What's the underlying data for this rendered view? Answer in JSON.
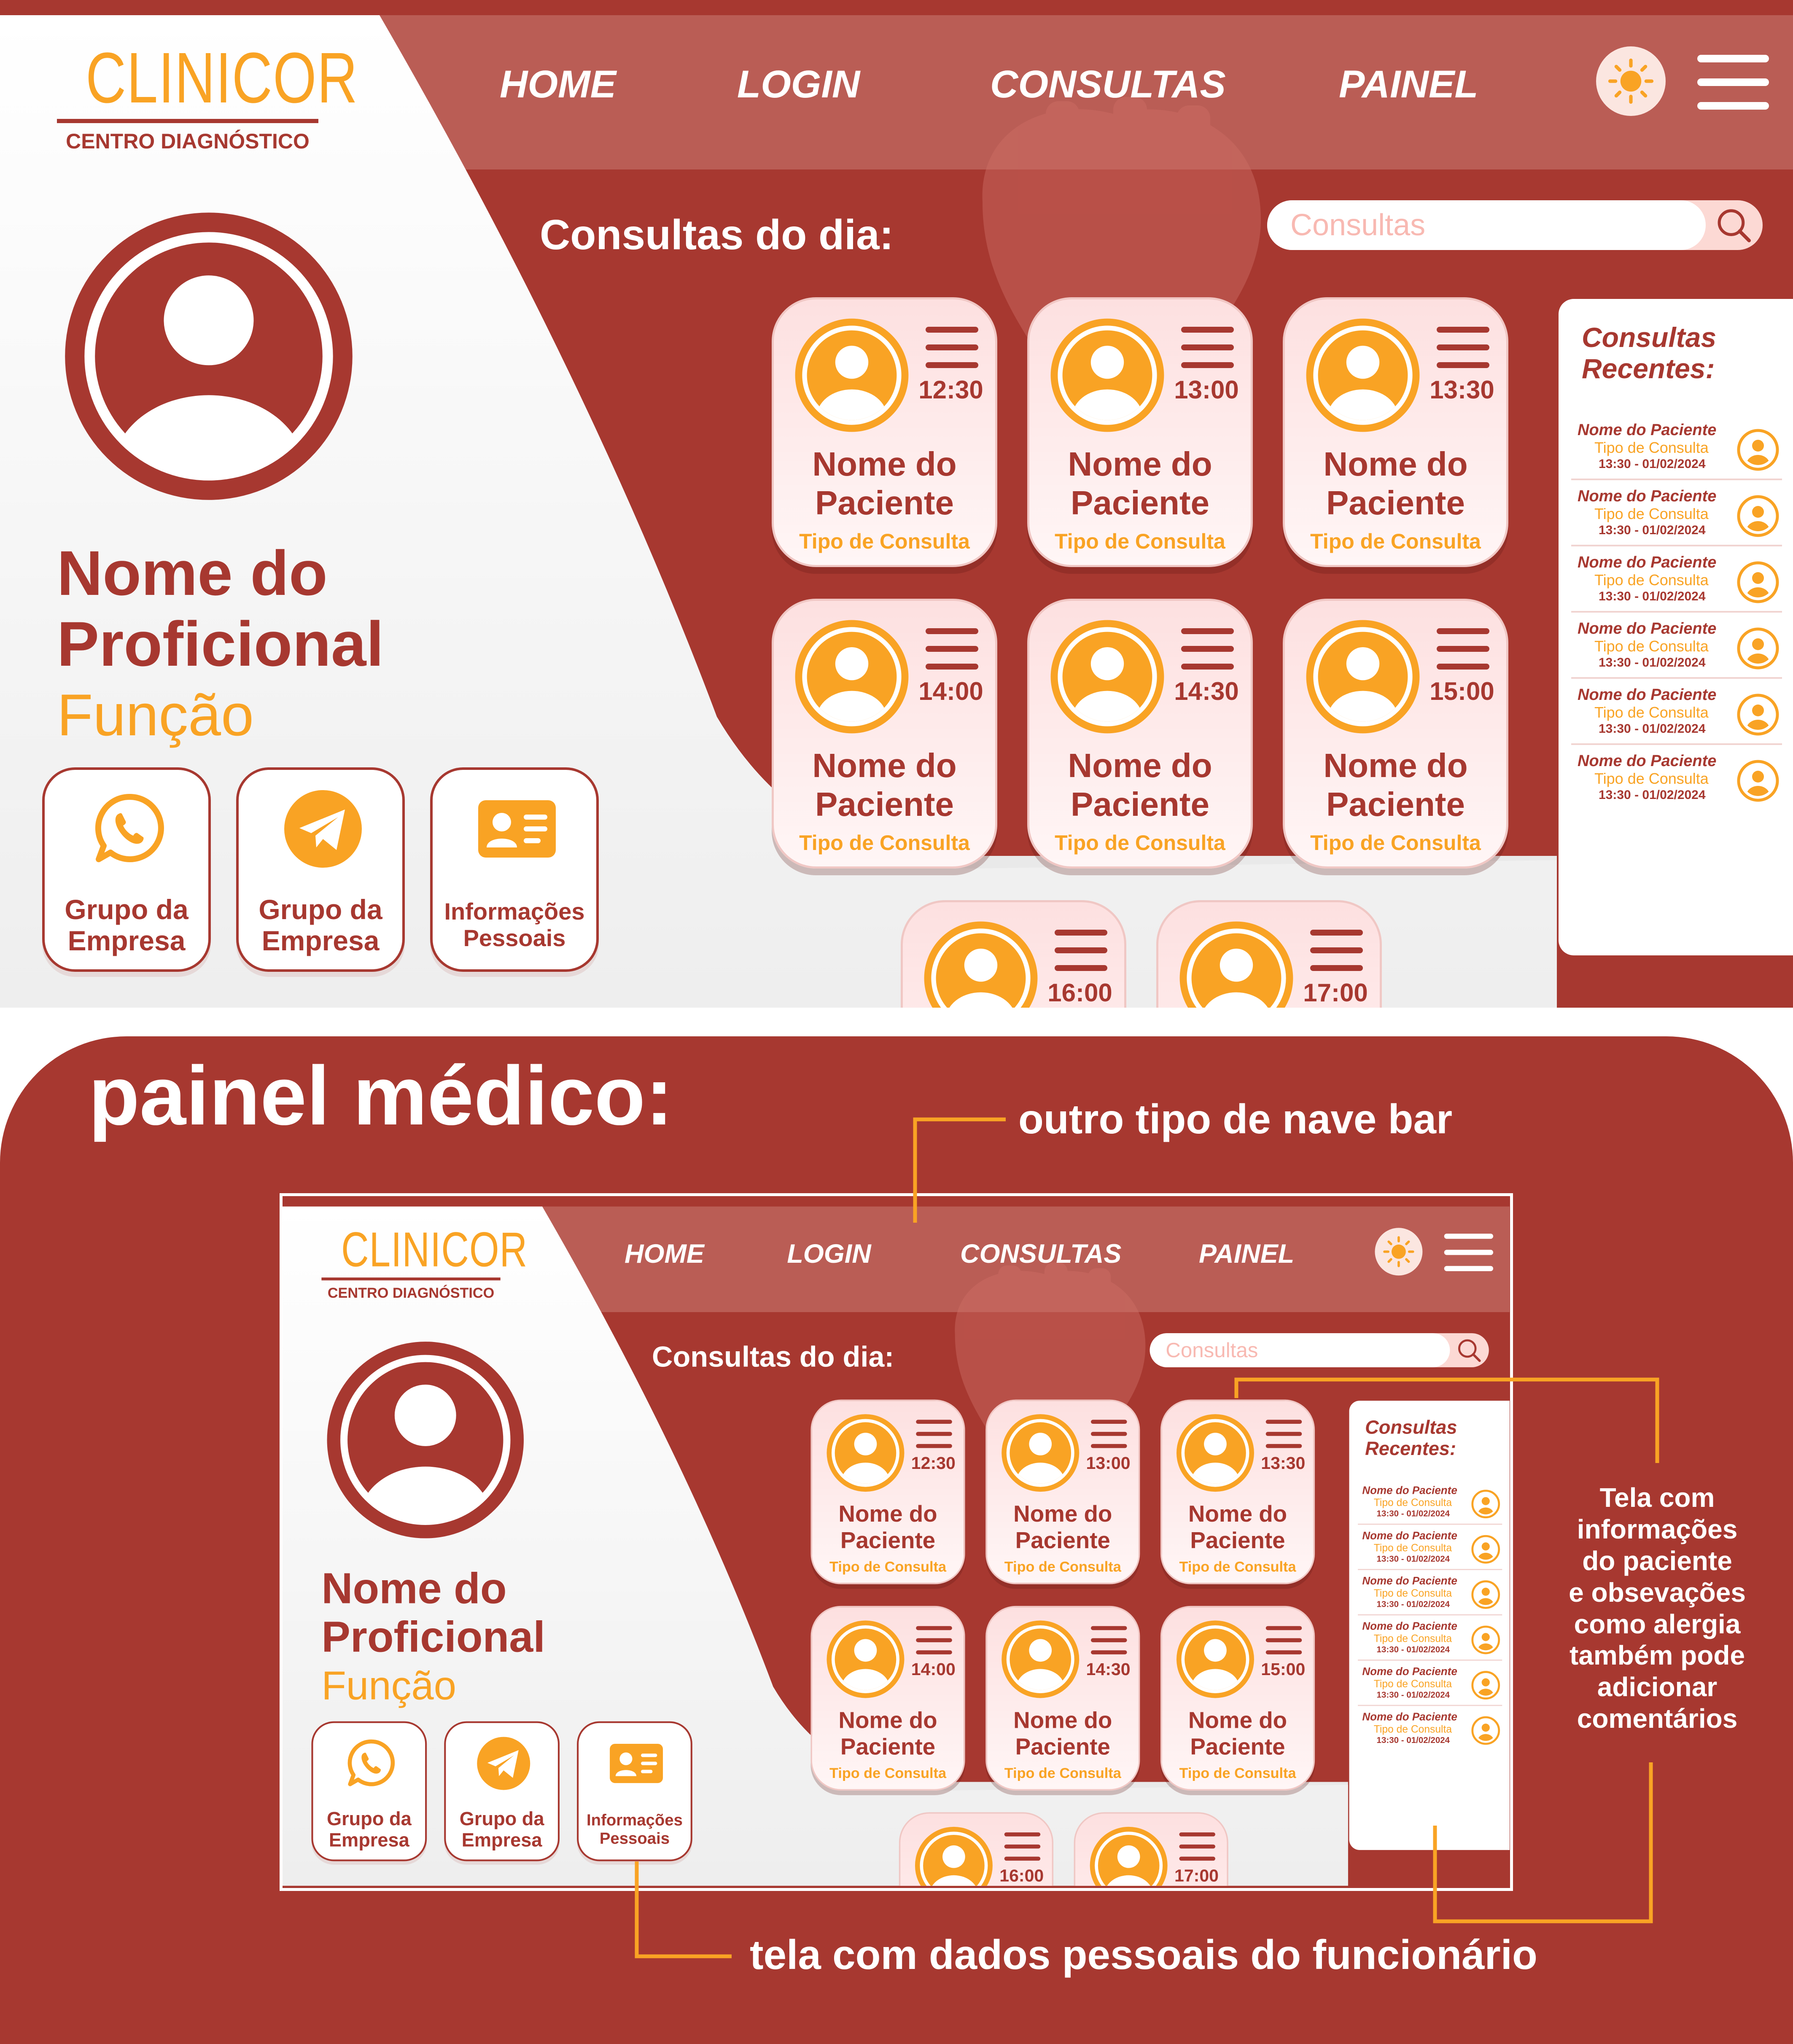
{
  "brand": {
    "name": "CLINICOR",
    "subtitle": "CENTRO DIAGNÓSTICO"
  },
  "nav": {
    "items": [
      "HOME",
      "LOGIN",
      "CONSULTAS",
      "PAINEL"
    ],
    "theme_toggle_icon": "sun-icon",
    "menu_icon": "hamburger-menu-icon"
  },
  "main": {
    "title": "Consultas do dia:",
    "search_placeholder": "Consultas",
    "search_icon": "search-icon"
  },
  "profile": {
    "name": "Nome do\nProficional",
    "role": "Função",
    "buttons": [
      {
        "label": "Grupo da\nEmpresa",
        "icon": "whatsapp-icon"
      },
      {
        "label": "Grupo da\nEmpresa",
        "icon": "telegram-icon"
      },
      {
        "label": "Informações\nPessoais",
        "icon": "id-card-icon"
      }
    ]
  },
  "appointments": [
    {
      "time": "12:30",
      "patient": "Nome do\nPaciente",
      "type": "Tipo de Consulta"
    },
    {
      "time": "13:00",
      "patient": "Nome do\nPaciente",
      "type": "Tipo de Consulta"
    },
    {
      "time": "13:30",
      "patient": "Nome do\nPaciente",
      "type": "Tipo de Consulta"
    },
    {
      "time": "14:00",
      "patient": "Nome do\nPaciente",
      "type": "Tipo de Consulta"
    },
    {
      "time": "14:30",
      "patient": "Nome do\nPaciente",
      "type": "Tipo de Consulta"
    },
    {
      "time": "15:00",
      "patient": "Nome do\nPaciente",
      "type": "Tipo de Consulta"
    },
    {
      "time": "16:00",
      "patient": "",
      "type": ""
    },
    {
      "time": "17:00",
      "patient": "",
      "type": ""
    }
  ],
  "recent": {
    "title": "Consultas\nRecentes:",
    "items": [
      {
        "name": "Nome do Paciente",
        "type": "Tipo de Consulta",
        "datetime": "13:30  -  01/02/2024"
      },
      {
        "name": "Nome do Paciente",
        "type": "Tipo de Consulta",
        "datetime": "13:30  -  01/02/2024"
      },
      {
        "name": "Nome do Paciente",
        "type": "Tipo de Consulta",
        "datetime": "13:30  -  01/02/2024"
      },
      {
        "name": "Nome do Paciente",
        "type": "Tipo de Consulta",
        "datetime": "13:30  -  01/02/2024"
      },
      {
        "name": "Nome do Paciente",
        "type": "Tipo de Consulta",
        "datetime": "13:30  -  01/02/2024"
      },
      {
        "name": "Nome do Paciente",
        "type": "Tipo de Consulta",
        "datetime": "13:30  -  01/02/2024"
      }
    ]
  },
  "presentation": {
    "title": "painel médico:",
    "annotation_nav": "outro tipo de nave bar",
    "annotation_patient": "Tela com\ninformações\ndo paciente\ne obsevações\ncomo alergia\ntambém pode\nadicionar\ncomentários",
    "annotation_personal": "tela com dados pessoais do funcionário"
  },
  "colors": {
    "brand_red": "#a73830",
    "accent_orange": "#f9a324",
    "card_pink": "#fde6e6"
  }
}
